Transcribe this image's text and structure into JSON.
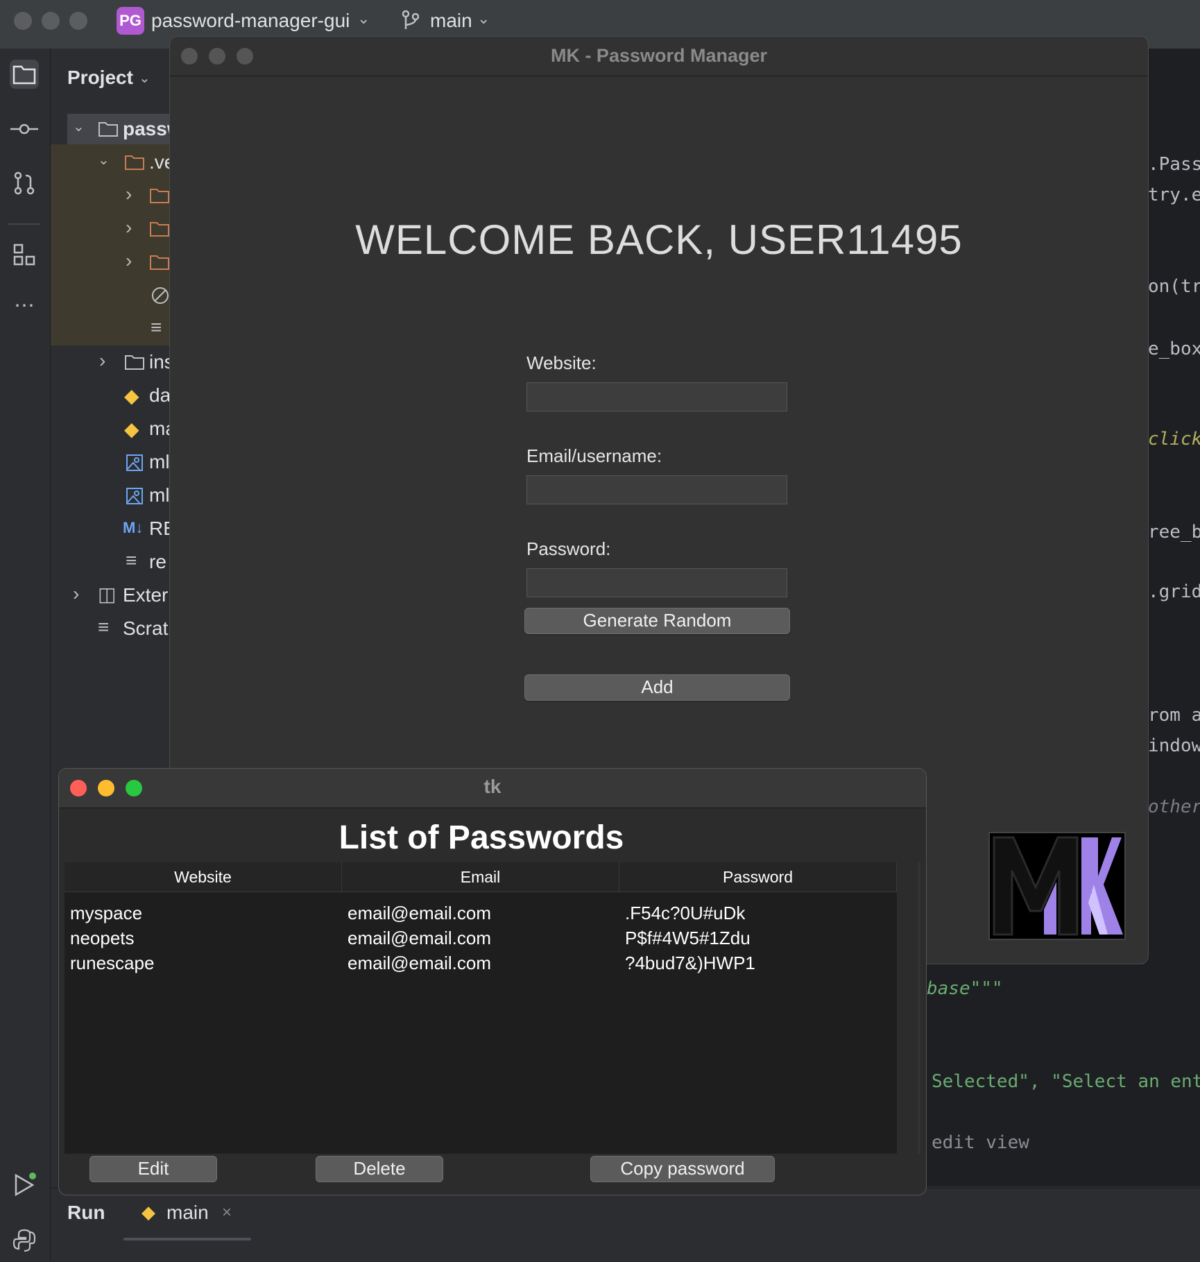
{
  "ide": {
    "project_badge": "PG",
    "project_name": "password-manager-gui",
    "branch": "main",
    "project_panel_title": "Project",
    "tree": [
      "passw",
      ".ve",
      "ins",
      "da",
      "ma",
      "ml",
      "ml",
      "RE",
      "re",
      "Exter",
      "Scrat"
    ],
    "run_label": "Run",
    "run_tab": "main",
    "code_fragments": [
      ".Pass",
      "try.e",
      "on(tr",
      "e_box",
      "click",
      "ree_b",
      ".grid",
      "rom a",
      "indow",
      "other",
      "base\"\"\"",
      "Selected\", \"Select an ent",
      "edit view"
    ]
  },
  "pm_window": {
    "title": "MK - Password Manager",
    "welcome": "WELCOME BACK, USER11495",
    "website_label": "Website:",
    "email_label": "Email/username:",
    "password_label": "Password:",
    "website_value": "",
    "email_value": "",
    "password_value": "",
    "generate_button": "Generate Random",
    "add_button": "Add",
    "logo_text": "MK"
  },
  "tk_window": {
    "title": "tk",
    "heading": "List of Passwords",
    "columns": [
      "Website",
      "Email",
      "Password"
    ],
    "rows": [
      [
        "myspace",
        "email@email.com",
        ".F54c?0U#uDk"
      ],
      [
        "neopets",
        "email@email.com",
        "P$f#4W5#1Zdu"
      ],
      [
        "runescape",
        "email@email.com",
        "?4bud7&)HWP1"
      ]
    ],
    "edit_button": "Edit",
    "delete_button": "Delete",
    "copy_button": "Copy password"
  },
  "colors": {
    "traffic_red": "#ff5f57",
    "traffic_yellow": "#febc2e",
    "traffic_green": "#28c840",
    "logo_purple": "#9f82e8"
  }
}
